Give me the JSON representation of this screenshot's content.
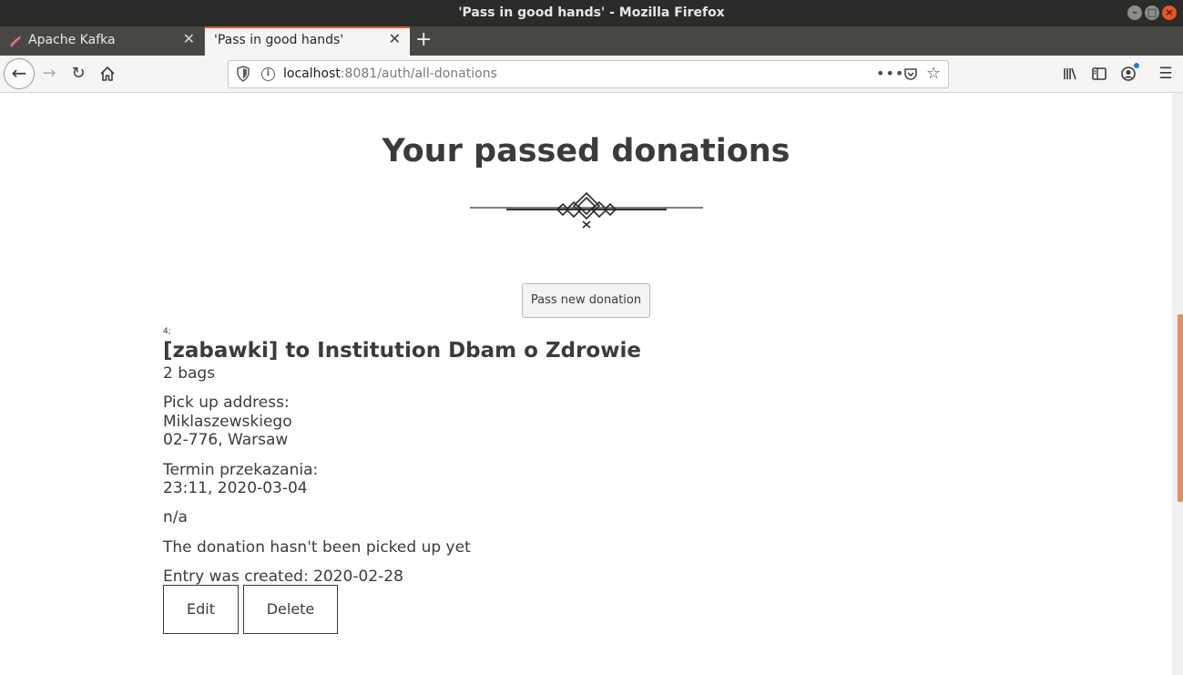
{
  "window": {
    "title": "'Pass in good hands' - Mozilla Firefox"
  },
  "tabs": [
    {
      "label": "Apache Kafka",
      "favicon": "kafka-icon"
    },
    {
      "label": "'Pass in good hands'",
      "active": true
    }
  ],
  "navbar": {
    "url_host": "localhost",
    "url_rest": ":8081/auth/all-donations",
    "page_actions": "•••"
  },
  "page": {
    "heading": "Your passed donations",
    "new_donation_button": "Pass new donation"
  },
  "donation": {
    "number": "4;",
    "title": "[zabawki] to Institution Dbam o Zdrowie",
    "bags": "2 bags",
    "pickup_label": "Pick up address:",
    "street": "Miklaszewskiego",
    "postal_city": "02-776, Warsaw",
    "term_label": "Termin przekazania:",
    "term_value": "23:11, 2020-03-04",
    "comment": "n/a",
    "status": "The donation hasn't been picked up yet",
    "created": "Entry was created: 2020-02-28",
    "edit_label": "Edit",
    "delete_label": "Delete"
  },
  "colors": {
    "accent": "#e95420",
    "scroll_thumb": "#ed8b5a",
    "text": "#3b3b3b"
  }
}
